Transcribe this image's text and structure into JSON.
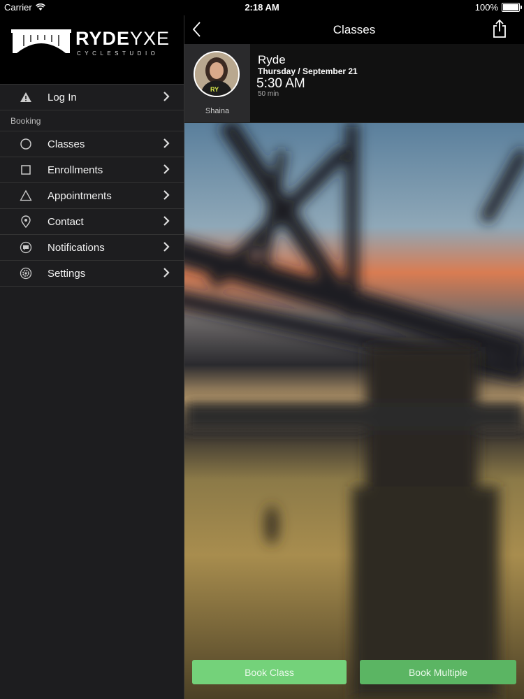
{
  "status_bar": {
    "carrier": "Carrier",
    "time": "2:18 AM",
    "battery": "100%"
  },
  "brand": {
    "name_bold": "RYDE",
    "name_light": "YXE",
    "tagline": "CYCLESTUDIO"
  },
  "sidebar": {
    "items": [
      {
        "label": "Log In",
        "icon": "warning-icon"
      },
      {
        "section": "Booking"
      },
      {
        "label": "Classes",
        "icon": "circle-icon"
      },
      {
        "label": "Enrollments",
        "icon": "square-icon"
      },
      {
        "label": "Appointments",
        "icon": "triangle-icon"
      },
      {
        "label": "Contact",
        "icon": "location-pin-icon"
      },
      {
        "label": "Notifications",
        "icon": "chat-bubble-icon"
      },
      {
        "label": "Settings",
        "icon": "gear-icon"
      }
    ]
  },
  "navbar": {
    "title": "Classes"
  },
  "class_info": {
    "instructor": "Shaina",
    "name": "Ryde",
    "date": "Thursday / September 21",
    "time": "5:30 AM",
    "duration": "50 min"
  },
  "actions": {
    "book_class": "Book Class",
    "book_multiple": "Book Multiple"
  },
  "colors": {
    "book_class_bg": "#74d27a",
    "book_multiple_bg": "#5bb563",
    "sidebar_bg": "#1d1d1f"
  }
}
